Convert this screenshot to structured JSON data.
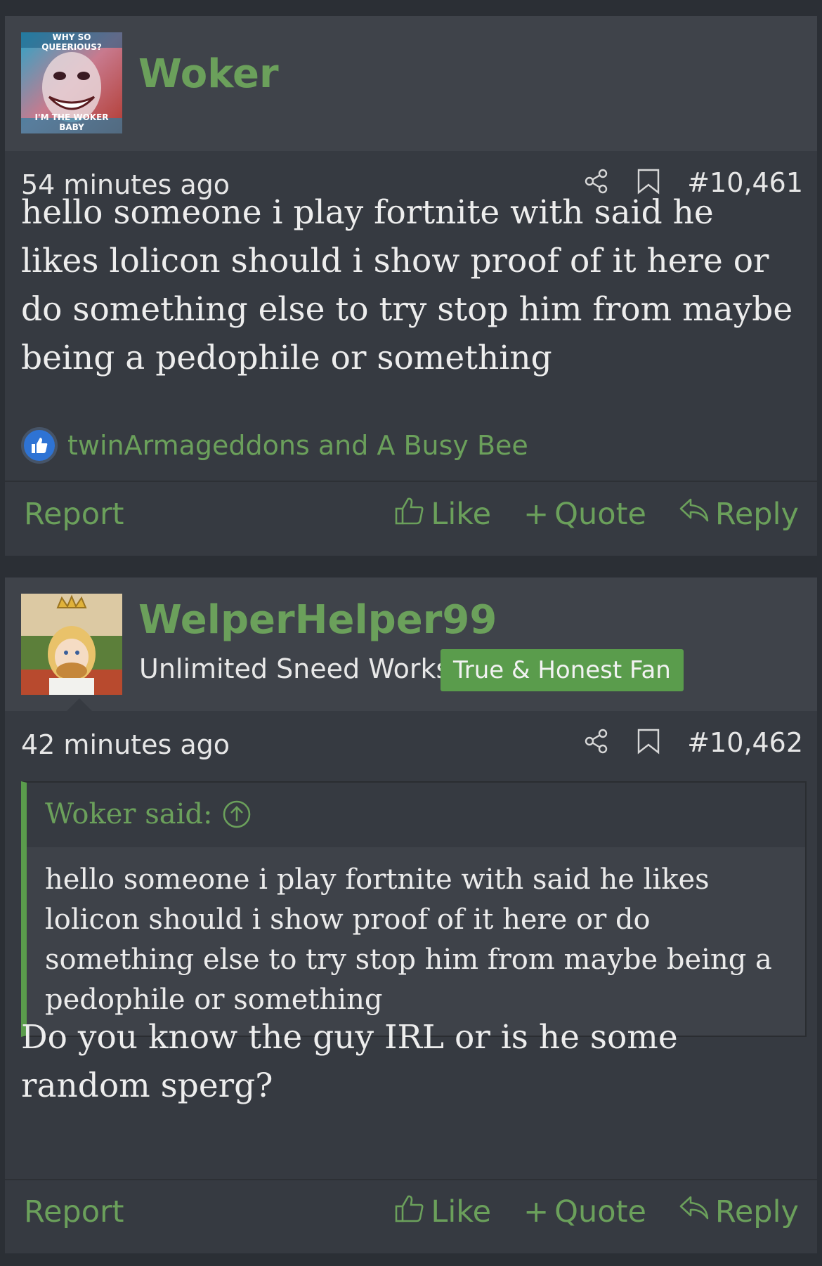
{
  "colors": {
    "page_bg": "#2b2f35",
    "post_bg": "#363a41",
    "header_bg": "#3f434a",
    "accent_green": "#6ba05b",
    "banner_green": "#5a9c4c",
    "like_blue": "#2e73d4"
  },
  "posts": [
    {
      "author": "Woker",
      "avatar_icon": "joker-avatar-image",
      "avatar_caption_top": "WHY SO QUEERIOUS?",
      "avatar_caption_bottom": "I'M THE WOKER BABY",
      "time": "54 minutes ago",
      "post_number": "#10,461",
      "message": "hello someone i play fortnite with said he likes lolicon should i show proof of it here or do something else to try stop him from maybe being a pedophile or something",
      "likes_text": "twinArmageddons and A Busy Bee",
      "footer": {
        "report": "Report",
        "like": "Like",
        "quote": "Quote",
        "reply": "Reply"
      }
    },
    {
      "author": "WelperHelper99",
      "avatar_icon": "anime-girl-burger-avatar-image",
      "user_title": "Unlimited Sneed Works",
      "banner": "True & Honest Fan",
      "time": "42 minutes ago",
      "post_number": "#10,462",
      "quote_author": "Woker said:",
      "quote_text": "hello someone i play fortnite with said he likes lolicon should i show proof of it here or do something else to try stop him from maybe being a pedophile or something",
      "message": "Do you know the guy IRL or is he some random sperg?",
      "footer": {
        "report": "Report",
        "like": "Like",
        "quote": "Quote",
        "reply": "Reply"
      }
    }
  ],
  "icons": [
    "share-icon",
    "bookmark-icon",
    "thumbs-up-icon",
    "plus-icon",
    "reply-icon",
    "arrow-up-circle-icon"
  ]
}
